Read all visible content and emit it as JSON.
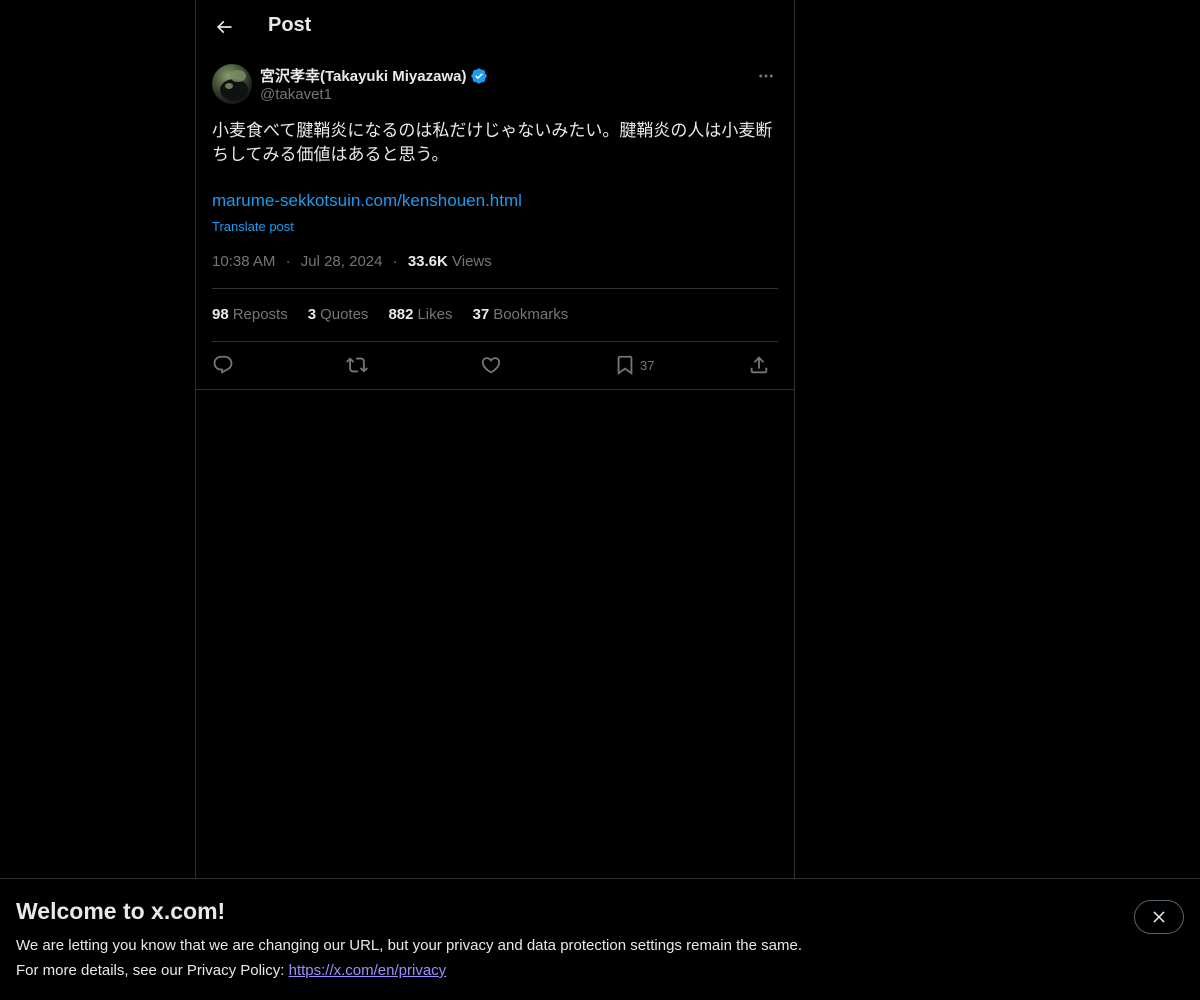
{
  "header": {
    "title": "Post"
  },
  "author": {
    "name": "宮沢孝幸(Takayuki Miyazawa)",
    "handle": "@takavet1",
    "verified_color": "#1d9bf0"
  },
  "post": {
    "text": "小麦食べて腱鞘炎になるのは私だけじゃないみたい。腱鞘炎の人は小麦断ちしてみる価値はあると思う。",
    "link": "marume-sekkotsuin.com/kenshouen.html",
    "translate_label": "Translate post",
    "time": "10:38 AM",
    "separator": "·",
    "date": "Jul 28, 2024",
    "views_count": "33.6K",
    "views_label": "Views"
  },
  "stats": {
    "reposts_count": "98",
    "reposts_label": "Reposts",
    "quotes_count": "3",
    "quotes_label": "Quotes",
    "likes_count": "882",
    "likes_label": "Likes",
    "bookmarks_count": "37",
    "bookmarks_label": "Bookmarks"
  },
  "actions": {
    "bookmark_count": "37",
    "icons": [
      "reply-icon",
      "repost-icon",
      "like-icon",
      "bookmark-icon",
      "share-icon"
    ]
  },
  "banner": {
    "title": "Welcome to x.com!",
    "line1": "We are letting you know that we are changing our URL, but your privacy and data protection settings remain the same.",
    "line2_prefix": "For more details, see our Privacy Policy:",
    "privacy_link": "https://x.com/en/privacy"
  },
  "colors": {
    "background": "#000000",
    "text": "#e7e9ea",
    "muted": "#71767b",
    "accent": "#1d9bf0",
    "divider": "#2f3336",
    "visited_link": "#a08cff"
  }
}
